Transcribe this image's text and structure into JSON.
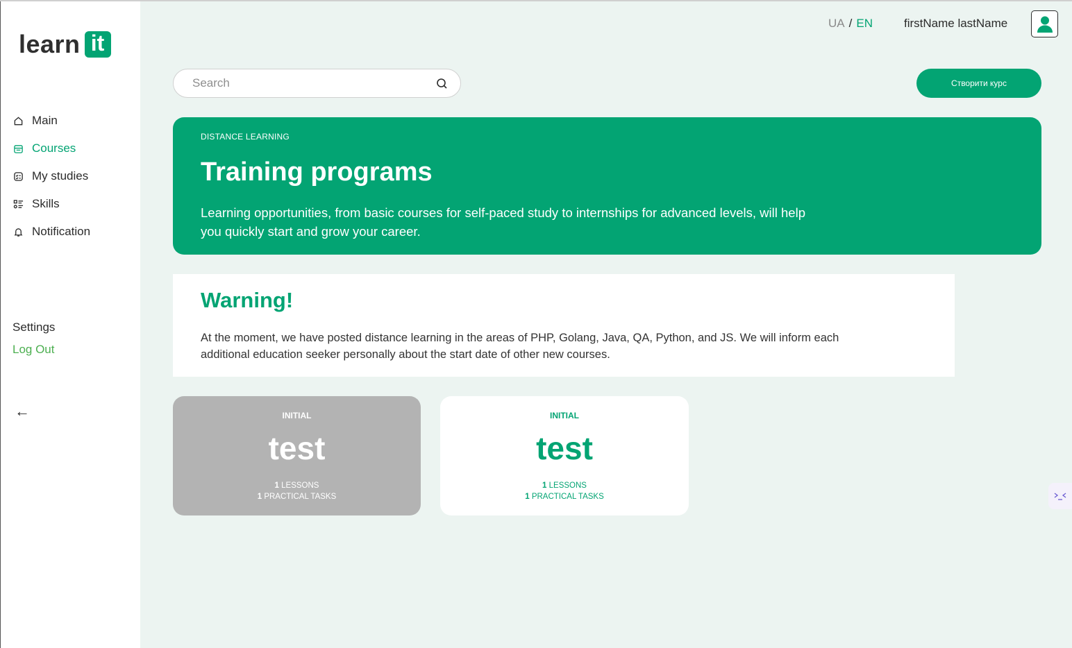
{
  "brand": {
    "logo_text": "learn",
    "logo_box": "it",
    "accent": "#03a473"
  },
  "sidebar": {
    "items": [
      {
        "label": "Main",
        "icon": "home-icon",
        "active": false
      },
      {
        "label": "Courses",
        "icon": "folder-icon",
        "active": true
      },
      {
        "label": "My studies",
        "icon": "checklist-icon",
        "active": false
      },
      {
        "label": "Skills",
        "icon": "list-icon",
        "active": false
      },
      {
        "label": "Notification",
        "icon": "bell-icon",
        "active": false
      }
    ],
    "settings_label": "Settings",
    "logout_label": "Log Out",
    "collapse_icon": "←"
  },
  "header": {
    "lang_ua": "UA",
    "lang_sep": "/",
    "lang_en": "EN",
    "username": "firstName lastName"
  },
  "search": {
    "placeholder": "Search",
    "value": ""
  },
  "create_button": "Створити курс",
  "hero": {
    "eyebrow": "DISTANCE LEARNING",
    "title": "Training programs",
    "description": "Learning opportunities, from basic courses for self-paced study to internships for advanced levels, will help you quickly start and grow your career."
  },
  "warning": {
    "title": "Warning!",
    "text": "At the moment, we have posted distance learning in the areas of PHP, Golang, Java, QA, Python, and JS. We will inform each additional education seeker personally about the start date of other new courses."
  },
  "courses": [
    {
      "level": "INITIAL",
      "title": "test",
      "lessons_count": "1",
      "lessons_label": "LESSONS",
      "tasks_count": "1",
      "tasks_label": "PRACTICAL TASKS"
    },
    {
      "level": "INITIAL",
      "title": "test",
      "lessons_count": "1",
      "lessons_label": "LESSONS",
      "tasks_count": "1",
      "tasks_label": "PRACTICAL TASKS"
    }
  ]
}
